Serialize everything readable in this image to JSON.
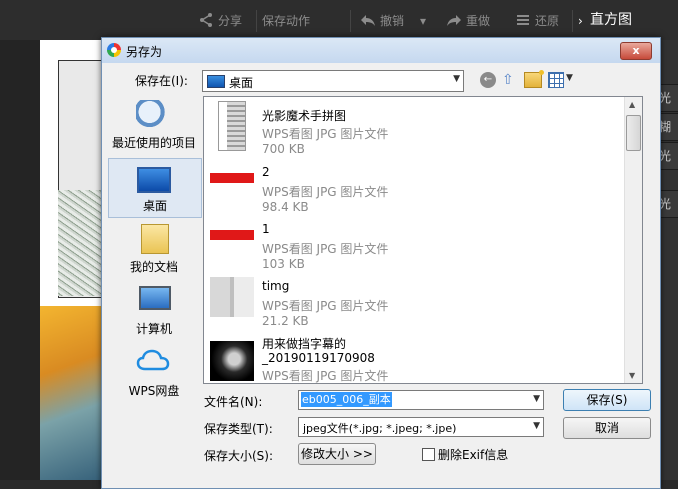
{
  "app": {
    "toolbar": {
      "share": "分享",
      "save_action": "保存动作",
      "undo": "撤销",
      "redo": "重做",
      "restore": "还原",
      "histogram": "直方图"
    },
    "side_buttons": [
      "光",
      "糊",
      "光",
      "光"
    ]
  },
  "dialog": {
    "title": "另存为",
    "close_label": "x",
    "save_in_label": "保存在(I):",
    "save_in_value": "桌面",
    "places": [
      {
        "label": "最近使用的项目",
        "icon": "recent-items-icon"
      },
      {
        "label": "桌面",
        "icon": "desktop-icon"
      },
      {
        "label": "我的文档",
        "icon": "documents-icon"
      },
      {
        "label": "计算机",
        "icon": "computer-icon"
      },
      {
        "label": "WPS网盘",
        "icon": "cloud-icon"
      }
    ],
    "files": [
      {
        "name": "光影魔术手拼图",
        "type": "WPS看图 JPG 图片文件",
        "size": "700 KB"
      },
      {
        "name": "2",
        "type": "WPS看图 JPG 图片文件",
        "size": "98.4 KB"
      },
      {
        "name": "1",
        "type": "WPS看图 JPG 图片文件",
        "size": "103 KB"
      },
      {
        "name": "timg",
        "type": "WPS看图 JPG 图片文件",
        "size": "21.2 KB"
      },
      {
        "name": "用来做挡字幕的_20190119170908",
        "name_line1": "用来做挡字幕的",
        "name_line2": "_20190119170908",
        "type": "WPS看图 JPG 图片文件",
        "size": ""
      }
    ],
    "file_name_label": "文件名(N):",
    "file_name_value": "eb005_006_副本",
    "file_type_label": "保存类型(T):",
    "file_type_value": "jpeg文件(*.jpg; *.jpeg; *.jpe)",
    "file_size_label": "保存大小(S):",
    "resize_button": "修改大小 >>",
    "exif_label": "删除Exif信息",
    "save_button": "保存(S)",
    "cancel_button": "取消"
  }
}
